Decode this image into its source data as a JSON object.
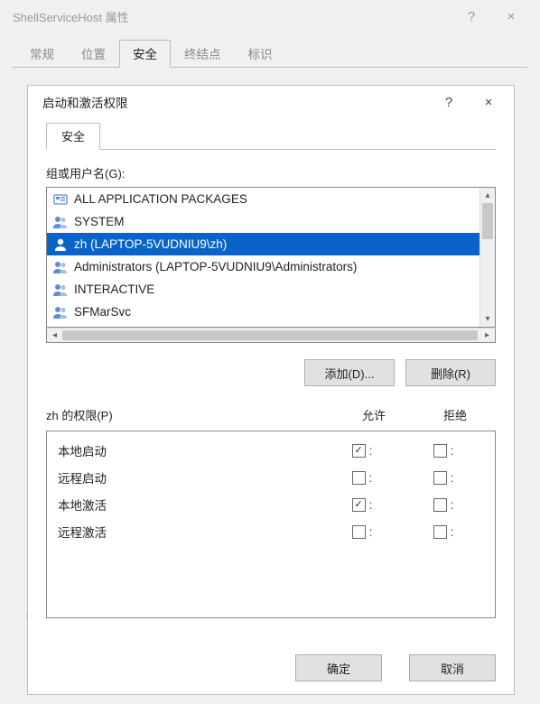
{
  "outer": {
    "title": "ShellServiceHost 属性",
    "help": "?",
    "close": "×",
    "tabs": [
      "常规",
      "位置",
      "安全",
      "终结点",
      "标识"
    ],
    "active_tab_index": 2,
    "truncated": "了"
  },
  "dialog": {
    "title": "启动和激活权限",
    "help": "?",
    "close": "×",
    "tab": "安全",
    "group_label": "组或用户名(G):",
    "users": [
      "ALL APPLICATION PACKAGES",
      "SYSTEM",
      "zh (LAPTOP-5VUDNIU9\\zh)",
      "Administrators (LAPTOP-5VUDNIU9\\Administrators)",
      "INTERACTIVE",
      "SFMarSvc"
    ],
    "selected_user_index": 2,
    "add_button": "添加(D)...",
    "remove_button": "删除(R)",
    "perm_header_label": "zh 的权限(P)",
    "perm_col_allow": "允许",
    "perm_col_deny": "拒绝",
    "permissions": [
      {
        "label": "本地启动",
        "allow": true,
        "deny": false
      },
      {
        "label": "远程启动",
        "allow": false,
        "deny": false
      },
      {
        "label": "本地激活",
        "allow": true,
        "deny": false
      },
      {
        "label": "远程激活",
        "allow": false,
        "deny": false
      }
    ],
    "ok_button": "确定",
    "cancel_button": "取消"
  }
}
